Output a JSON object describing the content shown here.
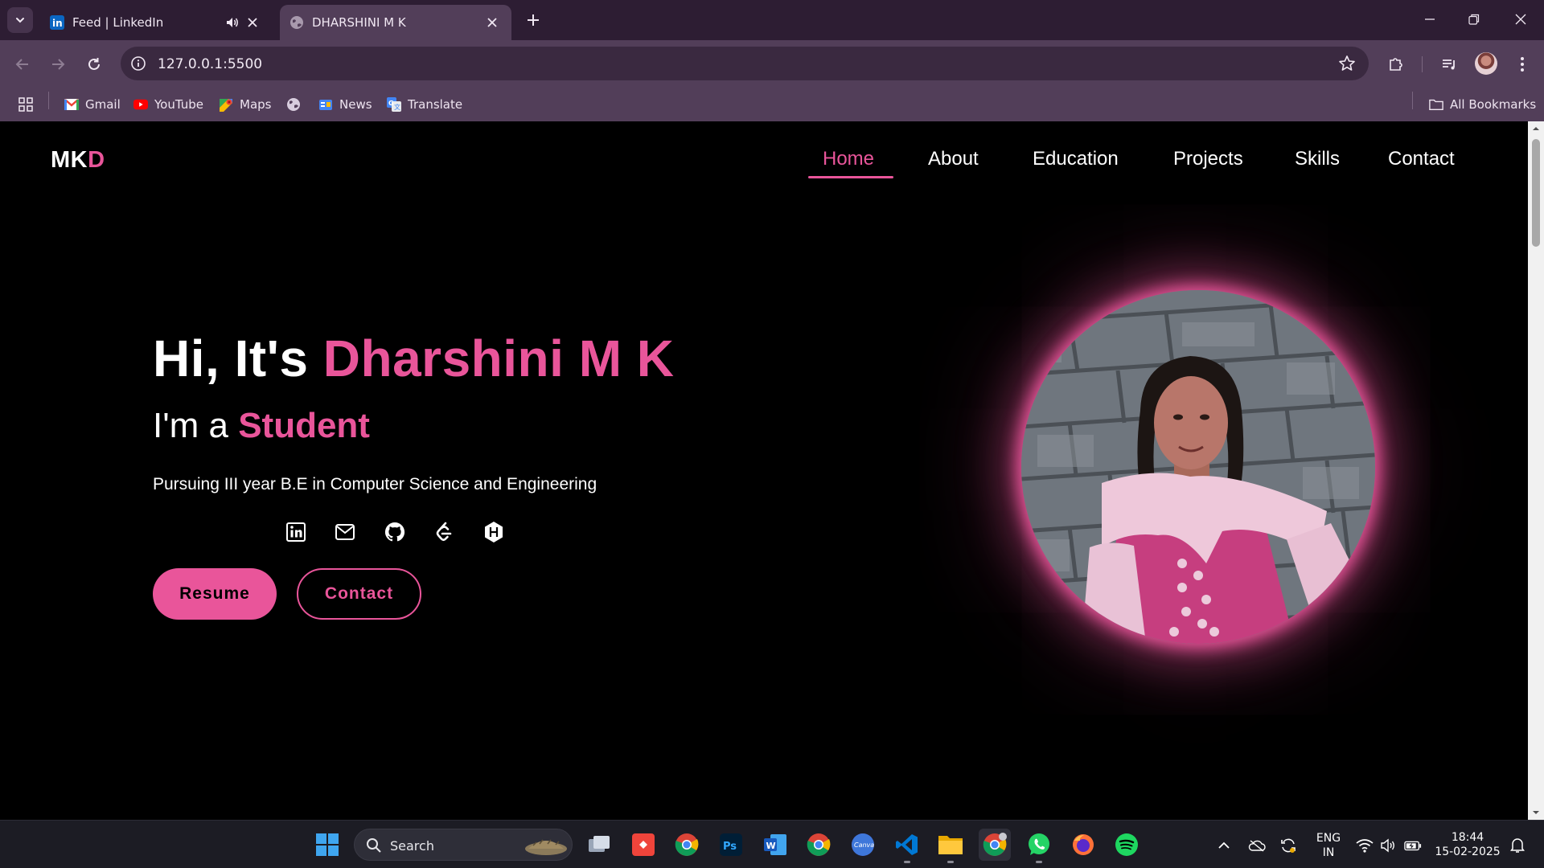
{
  "browser": {
    "tabs": [
      {
        "title": "Feed | LinkedIn",
        "active": false,
        "icon": "linkedin-icon"
      },
      {
        "title": "DHARSHINI M K",
        "active": true,
        "icon": "globe-icon"
      }
    ],
    "url": "127.0.0.1:5500",
    "bookmarks": [
      {
        "label": "Gmail",
        "icon": "gmail-icon"
      },
      {
        "label": "YouTube",
        "icon": "youtube-icon"
      },
      {
        "label": "Maps",
        "icon": "maps-icon"
      },
      {
        "label": "News",
        "icon": "news-icon"
      },
      {
        "label": "Translate",
        "icon": "translate-icon"
      }
    ],
    "all_bookmarks": "All Bookmarks"
  },
  "site": {
    "logo_main": "MK",
    "logo_accent": "D",
    "nav": [
      {
        "label": "Home",
        "active": true
      },
      {
        "label": "About"
      },
      {
        "label": "Education"
      },
      {
        "label": "Projects"
      },
      {
        "label": "Skills"
      },
      {
        "label": "Contact"
      }
    ],
    "hero": {
      "greeting": "Hi, It's ",
      "name": "Dharshini M K",
      "role_prefix": "I'm a ",
      "role": "Student",
      "description": "Pursuing III year B.E in Computer Science and Engineering",
      "socials": [
        "linkedin-icon",
        "mail-icon",
        "github-icon",
        "leetcode-icon",
        "hackerrank-icon"
      ],
      "buttons": {
        "resume": "Resume",
        "contact": "Contact"
      }
    },
    "colors": {
      "accent": "#e9559a",
      "background": "#000000",
      "text": "#ffffff"
    }
  },
  "taskbar": {
    "search_label": "Search",
    "language": "ENG",
    "region": "IN",
    "time": "18:44",
    "date": "15-02-2025"
  }
}
